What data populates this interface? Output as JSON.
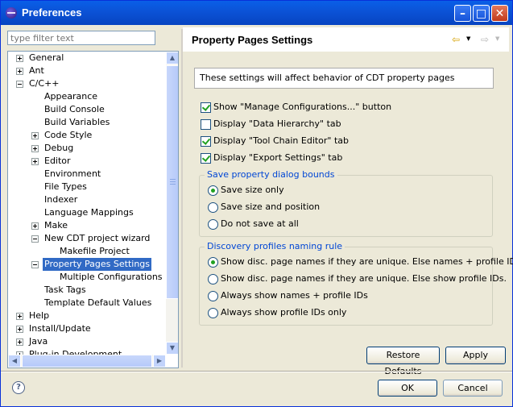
{
  "window": {
    "title": "Preferences"
  },
  "filter": {
    "placeholder": "type filter text"
  },
  "tree": {
    "items": [
      {
        "label": "General",
        "indent": 0,
        "expander": "plus"
      },
      {
        "label": "Ant",
        "indent": 0,
        "expander": "plus"
      },
      {
        "label": "C/C++",
        "indent": 0,
        "expander": "minus"
      },
      {
        "label": "Appearance",
        "indent": 1,
        "expander": "none"
      },
      {
        "label": "Build Console",
        "indent": 1,
        "expander": "none"
      },
      {
        "label": "Build Variables",
        "indent": 1,
        "expander": "none"
      },
      {
        "label": "Code Style",
        "indent": 1,
        "expander": "plus"
      },
      {
        "label": "Debug",
        "indent": 1,
        "expander": "plus"
      },
      {
        "label": "Editor",
        "indent": 1,
        "expander": "plus"
      },
      {
        "label": "Environment",
        "indent": 1,
        "expander": "none"
      },
      {
        "label": "File Types",
        "indent": 1,
        "expander": "none"
      },
      {
        "label": "Indexer",
        "indent": 1,
        "expander": "none"
      },
      {
        "label": "Language Mappings",
        "indent": 1,
        "expander": "none"
      },
      {
        "label": "Make",
        "indent": 1,
        "expander": "plus"
      },
      {
        "label": "New CDT project wizard",
        "indent": 1,
        "expander": "minus"
      },
      {
        "label": "Makefile Project",
        "indent": 2,
        "expander": "none"
      },
      {
        "label": "Property Pages Settings",
        "indent": 1,
        "expander": "minus",
        "selected": true
      },
      {
        "label": "Multiple Configurations Edit",
        "indent": 2,
        "expander": "none"
      },
      {
        "label": "Task Tags",
        "indent": 1,
        "expander": "none"
      },
      {
        "label": "Template Default Values",
        "indent": 1,
        "expander": "none"
      },
      {
        "label": "Help",
        "indent": 0,
        "expander": "plus"
      },
      {
        "label": "Install/Update",
        "indent": 0,
        "expander": "plus"
      },
      {
        "label": "Java",
        "indent": 0,
        "expander": "plus"
      },
      {
        "label": "Plug-in Development",
        "indent": 0,
        "expander": "plus"
      }
    ]
  },
  "page": {
    "title": "Property Pages Settings",
    "description": "These settings will affect behavior of CDT property pages",
    "checkboxes": [
      {
        "label": "Show \"Manage Configurations...\" button",
        "checked": true
      },
      {
        "label": "Display \"Data Hierarchy\" tab",
        "checked": false
      },
      {
        "label": "Display \"Tool Chain Editor\" tab",
        "checked": true
      },
      {
        "label": "Display \"Export Settings\" tab",
        "checked": true
      }
    ],
    "bounds_group": {
      "title": "Save property dialog bounds",
      "options": [
        {
          "label": "Save size only",
          "selected": true
        },
        {
          "label": "Save size and position",
          "selected": false
        },
        {
          "label": "Do not save at all",
          "selected": false
        }
      ]
    },
    "naming_group": {
      "title": "Discovery profiles naming rule",
      "options": [
        {
          "label": "Show disc. page names if they are unique. Else names + profile IDs.",
          "selected": true
        },
        {
          "label": "Show disc. page names if they are unique. Else show profile IDs.",
          "selected": false
        },
        {
          "label": "Always show names + profile IDs",
          "selected": false
        },
        {
          "label": "Always show profile IDs only",
          "selected": false
        }
      ]
    },
    "restore_label": "Restore Defaults",
    "apply_label": "Apply"
  },
  "footer": {
    "ok_label": "OK",
    "cancel_label": "Cancel"
  },
  "icons": {
    "back": "back-arrow-icon",
    "forward": "forward-arrow-icon",
    "help": "help-icon",
    "minimize": "minimize-icon",
    "maximize": "maximize-icon",
    "close": "close-icon"
  },
  "colors": {
    "selection": "#316ac5",
    "group_title": "#0046d5",
    "title_bar": "#0b52d6",
    "check_mark": "#21a121"
  }
}
